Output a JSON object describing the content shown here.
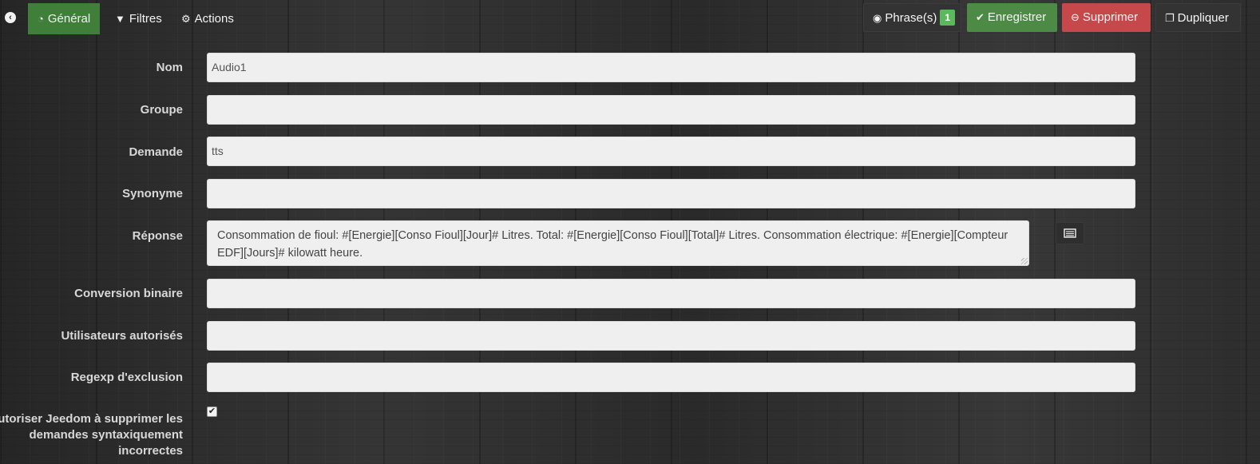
{
  "tabs": [
    {
      "label": "Général",
      "icon": "dashboard-icon"
    },
    {
      "label": "Filtres",
      "icon": "filter-icon"
    },
    {
      "label": "Actions",
      "icon": "cogs-icon"
    }
  ],
  "toolbar": {
    "phrases_label": "Phrase(s)",
    "phrases_count": "1",
    "save_label": "Enregistrer",
    "delete_label": "Supprimer",
    "duplicate_label": "Dupliquer"
  },
  "form": {
    "nom": {
      "label": "Nom",
      "value": "Audio1"
    },
    "groupe": {
      "label": "Groupe",
      "value": ""
    },
    "demande": {
      "label": "Demande",
      "value": "tts"
    },
    "synonyme": {
      "label": "Synonyme",
      "value": ""
    },
    "reponse": {
      "label": "Réponse",
      "value": "Consommation de fioul: #[Energie][Conso Fioul][Jour]# Litres. Total:  #[Energie][Conso Fioul][Total]# Litres. Consommation électrique: #[Energie][Compteur EDF][Jours]# kilowatt heure."
    },
    "conversion": {
      "label": "Conversion binaire",
      "value": ""
    },
    "utilisateurs": {
      "label": "Utilisateurs autorisés",
      "value": ""
    },
    "regexp": {
      "label": "Regexp d'exclusion",
      "value": ""
    },
    "autoriser": {
      "label": "Autoriser Jeedom à supprimer les demandes syntaxiquement incorrectes",
      "checked": true
    }
  },
  "colors": {
    "green": "#4d8a45",
    "red": "#c7484a",
    "badge": "#5cb85c",
    "field": "#efefef"
  }
}
